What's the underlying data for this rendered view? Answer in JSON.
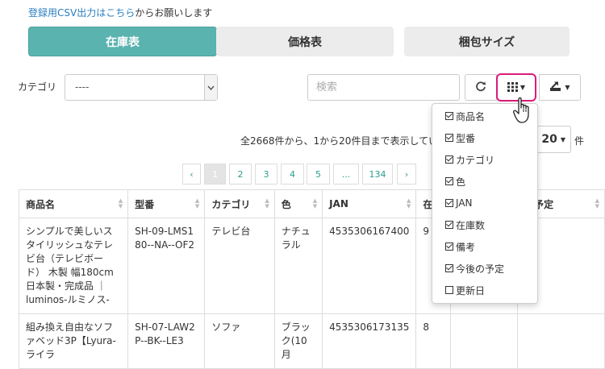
{
  "note": {
    "link": "登録用CSV出力はこちら",
    "rest": "からお願いします"
  },
  "tabs": [
    "在庫表",
    "価格表",
    "梱包サイズ"
  ],
  "filter": {
    "category_label": "カテゴリ",
    "category_value": "----",
    "search_placeholder": "検索"
  },
  "info": {
    "text": "全2668件から、1から20件目まで表示していま",
    "page_size": "20",
    "unit": "件"
  },
  "pagination": [
    "‹",
    "1",
    "2",
    "3",
    "4",
    "5",
    "...",
    "134",
    "›"
  ],
  "table": {
    "headers": [
      "商品名",
      "型番",
      "カテゴリ",
      "色",
      "JAN",
      "在庫",
      "",
      "の予定"
    ],
    "rows": [
      [
        "シンプルで美しいスタイリッシュなテレビ台（テレビボード） 木製 幅180cm 日本製・完成品 ｜luminos-ルミノス-",
        "SH-09-LMS180--NA--OF2",
        "テレビ台",
        "ナチュラル",
        "4535306167400",
        "9",
        "",
        ""
      ],
      [
        "組み換え自由なソファベッド3P【Lyura-ライラ",
        "SH-07-LAW2P--BK--LE3",
        "ソファ",
        "ブラック(10月",
        "4535306173135",
        "8",
        "",
        ""
      ]
    ]
  },
  "menu": {
    "items": [
      {
        "label": "商品名",
        "checked": true
      },
      {
        "label": "型番",
        "checked": true
      },
      {
        "label": "カテゴリ",
        "checked": true
      },
      {
        "label": "色",
        "checked": true
      },
      {
        "label": "JAN",
        "checked": true
      },
      {
        "label": "在庫数",
        "checked": true
      },
      {
        "label": "備考",
        "checked": true
      },
      {
        "label": "今後の予定",
        "checked": true
      },
      {
        "label": "更新日",
        "checked": false
      }
    ]
  },
  "colors": {
    "accent": "#5bb3b0",
    "link": "#2a7ec1",
    "highlight_border": "#d91c7b"
  },
  "icons": [
    "refresh-icon",
    "grid-icon",
    "export-icon",
    "hand-cursor-icon",
    "chevron-down-icon",
    "sort-icon"
  ]
}
